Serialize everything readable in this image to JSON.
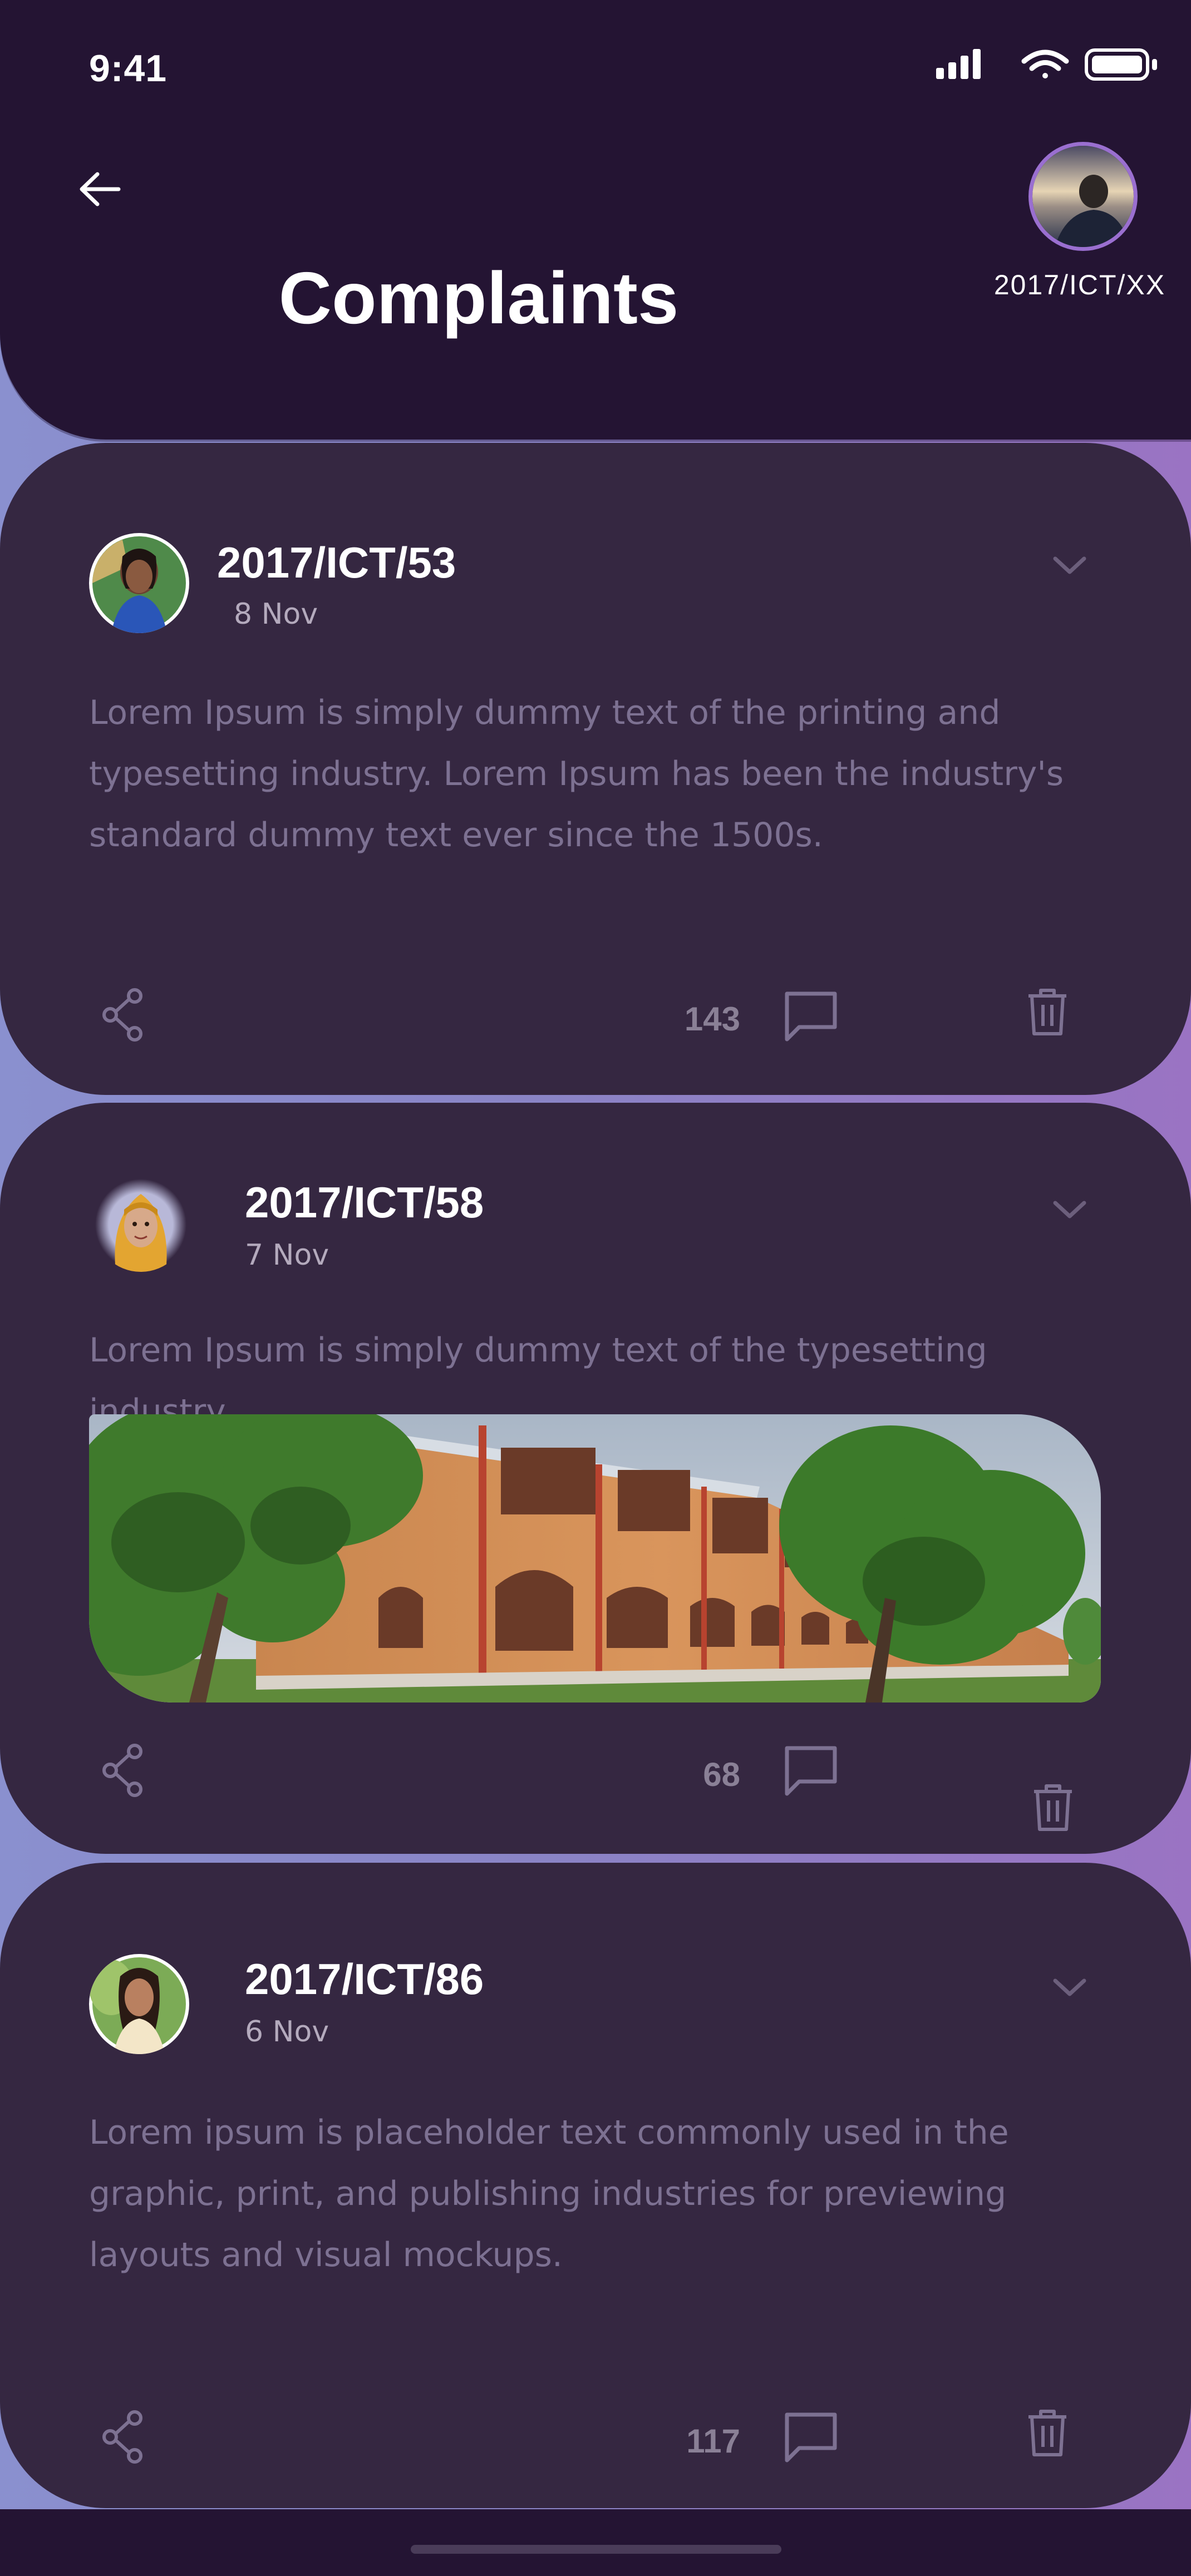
{
  "status_bar": {
    "time": "9:41"
  },
  "header": {
    "back_icon": "arrow-left-icon",
    "title": "Complaints",
    "profile_id": "2017/ICT/XX"
  },
  "colors": {
    "header_bg": "#241433",
    "card_bg": "#352741",
    "text_primary": "#ffffff",
    "text_muted": "#7d7192",
    "icon_muted": "#8a8096",
    "gradient_start": "#8a90cf",
    "gradient_end": "#9a73c3"
  },
  "complaints": [
    {
      "author": "2017/ICT/53",
      "date": "8 Nov",
      "text": "Lorem Ipsum is simply dummy text of the printing and typesetting industry. Lorem Ipsum has been the industry's standard dummy text ever since the 1500s.",
      "comment_count": "143"
    },
    {
      "author": "2017/ICT/58",
      "date": "7 Nov",
      "text": "Lorem Ipsum is simply dummy text of the typesetting industry.",
      "comment_count": "68"
    },
    {
      "author": "2017/ICT/86",
      "date": "6 Nov",
      "text": "Lorem ipsum is placeholder text commonly used in the graphic, print, and publishing industries for previewing layouts and visual mockups.",
      "comment_count": "117"
    }
  ]
}
